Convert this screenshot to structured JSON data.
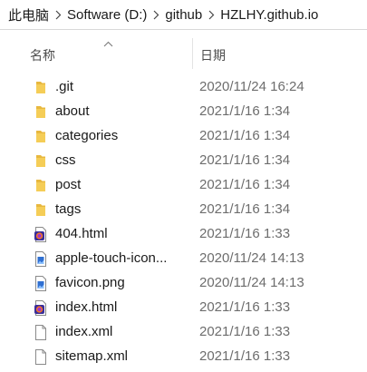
{
  "breadcrumb": [
    "此电脑",
    "Software (D:)",
    "github",
    "HZLHY.github.io"
  ],
  "columns": {
    "name": "名称",
    "date": "日期"
  },
  "files": [
    {
      "name": ".git",
      "date": "2020/11/24 16:24",
      "icon": "folder-icon"
    },
    {
      "name": "about",
      "date": "2021/1/16 1:34",
      "icon": "folder-icon"
    },
    {
      "name": "categories",
      "date": "2021/1/16 1:34",
      "icon": "folder-icon"
    },
    {
      "name": "css",
      "date": "2021/1/16 1:34",
      "icon": "folder-icon"
    },
    {
      "name": "post",
      "date": "2021/1/16 1:34",
      "icon": "folder-icon"
    },
    {
      "name": "tags",
      "date": "2021/1/16 1:34",
      "icon": "folder-icon"
    },
    {
      "name": "404.html",
      "date": "2021/1/16 1:33",
      "icon": "html-file-icon"
    },
    {
      "name": "apple-touch-icon...",
      "date": "2020/11/24 14:13",
      "icon": "image-file-icon"
    },
    {
      "name": "favicon.png",
      "date": "2020/11/24 14:13",
      "icon": "image-file-icon"
    },
    {
      "name": "index.html",
      "date": "2021/1/16 1:33",
      "icon": "html-file-icon"
    },
    {
      "name": "index.xml",
      "date": "2021/1/16 1:33",
      "icon": "blank-file-icon"
    },
    {
      "name": "sitemap.xml",
      "date": "2021/1/16 1:33",
      "icon": "blank-file-icon"
    }
  ],
  "colors": {
    "folder": "#e8b83f",
    "folder_front": "#f5cd57",
    "html_badge": "#3b2f9a",
    "image_badge": "#2f6fd1"
  }
}
